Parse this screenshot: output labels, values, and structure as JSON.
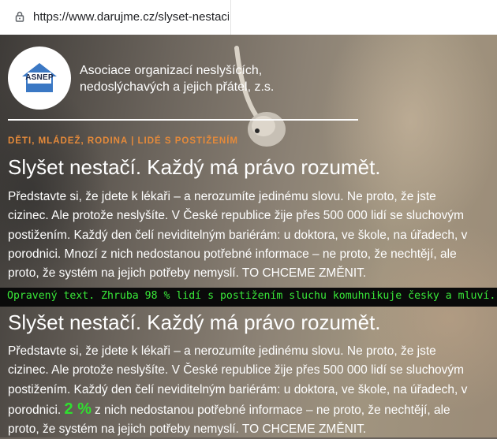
{
  "browser": {
    "url": "https://www.darujme.cz/slyset-nestaci",
    "lock_icon": "lock-icon"
  },
  "header": {
    "logo_text": "ASNEP",
    "org_line1": "Asociace organizací neslyšících,",
    "org_line2": "nedoslýchavých a jejich přátel, z.s."
  },
  "category": {
    "tag1": "DĚTI, MLÁDEŽ, RODINA",
    "separator": "|",
    "tag2": "LIDÉ S POSTIŽENÍM"
  },
  "original": {
    "title": "Slyšet nestačí. Každý má právo rozumět.",
    "lines": [
      "Představte si, že jdete k lékaři – a nerozumíte jedinému slovu. Ne proto, že jste",
      "cizinec. Ale protože neslyšíte. V České republice žije přes 500 000 lidí se sluchovým",
      "postižením. Každý den čelí neviditelným bariérám: u doktora, ve škole, na úřadech, v",
      "porodnici. Mnozí z nich nedostanou potřebné informace – ne proto, že nechtějí, ale",
      "proto, že systém na jejich potřeby nemyslí. TO CHCEME ZMĚNIT."
    ]
  },
  "banner": {
    "text": "Opravený text. Zhruba 98 % lidí s postižením sluchu komuhnikuje česky a mluví."
  },
  "corrected": {
    "title": "Slyšet nestačí. Každý má právo rozumět.",
    "lines": [
      "Představte si, že jdete k lékaři – a nerozumíte jedinému slovu. Ne proto, že jste",
      "cizinec. Ale protože neslyšíte. V České republice žije přes 500 000 lidí se sluchovým",
      "postižením. Každý den čelí neviditelným bariérám: u doktora, ve škole, na úřadech, v"
    ],
    "line4_prefix": "porodnici.",
    "highlight": "2 %",
    "line4_suffix": "z nich nedostanou potřebné informace – ne proto, že nechtějí, ale",
    "line5": "proto, že systém na jejich potřeby nemyslí. TO CHCEME ZMĚNIT."
  },
  "colors": {
    "category": "#e58a3a",
    "banner_text": "#39e839",
    "highlight": "#2fe02f"
  }
}
